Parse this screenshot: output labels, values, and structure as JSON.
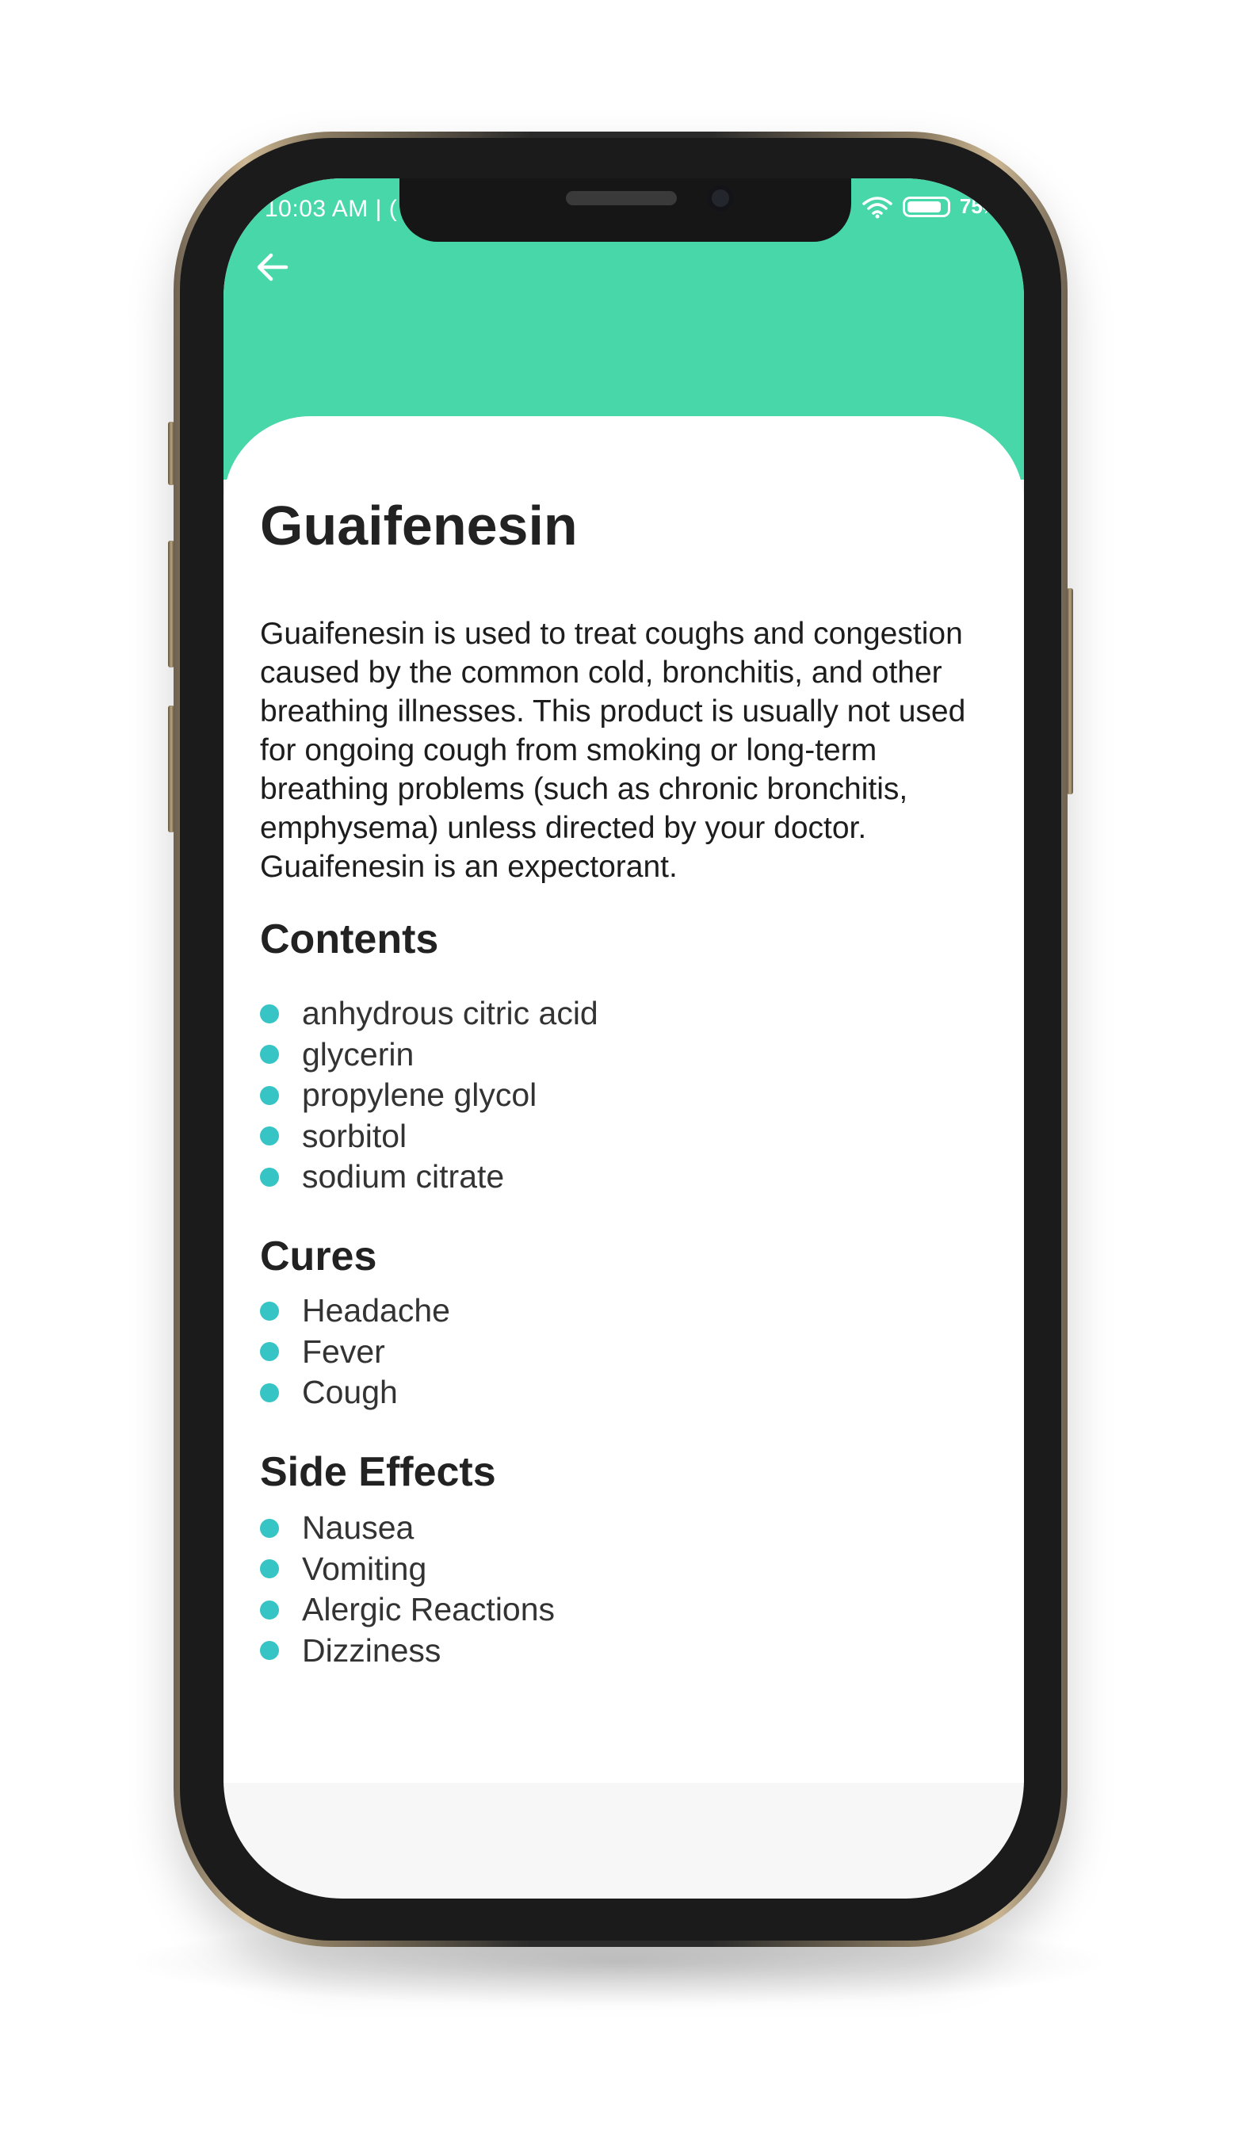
{
  "status_bar": {
    "time": "10:03 AM | (",
    "battery_level": "75"
  },
  "colors": {
    "header": "#48d7a8",
    "bullet": "#36c4c4"
  },
  "navigation": {
    "back_icon": "arrow-left-icon"
  },
  "medicine": {
    "name": "Guaifenesin",
    "description": "Guaifenesin is used to treat coughs and congestion caused by the common cold, bronchitis, and other breathing illnesses. This product is usually not used for ongoing cough from smoking or long-term breathing problems (such as chronic bronchitis, emphysema) unless directed by your doctor. Guaifenesin is an expectorant."
  },
  "sections": {
    "contents": {
      "title": "Contents",
      "items": [
        "anhydrous citric acid",
        "glycerin",
        "propylene glycol",
        "sorbitol",
        "sodium citrate"
      ]
    },
    "cures": {
      "title": "Cures",
      "items": [
        "Headache",
        "Fever",
        "Cough"
      ]
    },
    "side_effects": {
      "title": "Side Effects",
      "items": [
        "Nausea",
        "Vomiting",
        "Alergic Reactions",
        "Dizziness"
      ]
    }
  }
}
